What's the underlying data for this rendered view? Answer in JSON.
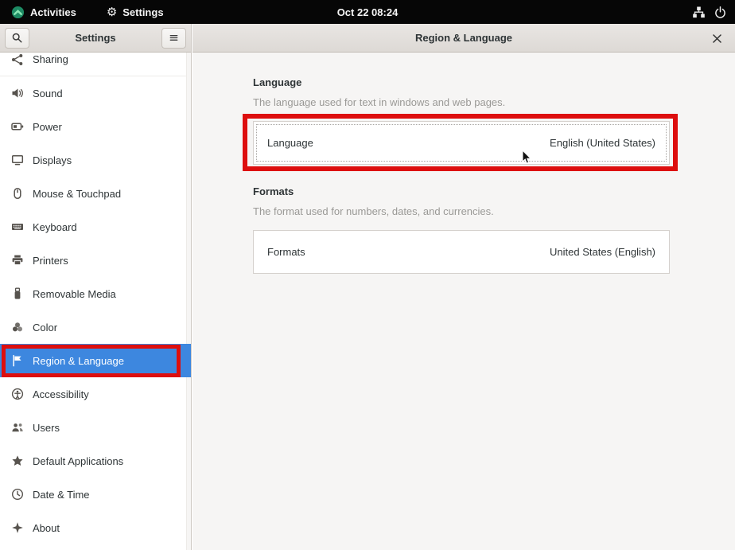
{
  "topbar": {
    "activities_label": "Activities",
    "settings_menu_label": "Settings",
    "clock": "Oct 22 08:24",
    "right_icons": [
      "network-icon",
      "power-icon"
    ]
  },
  "sidebar": {
    "title": "Settings",
    "items": [
      {
        "id": "sharing",
        "label": "Sharing",
        "icon": "share",
        "clipped": true
      },
      {
        "id": "sound",
        "label": "Sound",
        "icon": "sound"
      },
      {
        "id": "power",
        "label": "Power",
        "icon": "battery"
      },
      {
        "id": "displays",
        "label": "Displays",
        "icon": "display"
      },
      {
        "id": "mouse-touchpad",
        "label": "Mouse & Touchpad",
        "icon": "mouse"
      },
      {
        "id": "keyboard",
        "label": "Keyboard",
        "icon": "keyboard"
      },
      {
        "id": "printers",
        "label": "Printers",
        "icon": "printer"
      },
      {
        "id": "removable-media",
        "label": "Removable Media",
        "icon": "usb"
      },
      {
        "id": "color",
        "label": "Color",
        "icon": "color"
      },
      {
        "id": "region-language",
        "label": "Region & Language",
        "icon": "flag",
        "selected": true,
        "annotated": true
      },
      {
        "id": "accessibility",
        "label": "Accessibility",
        "icon": "accessibility"
      },
      {
        "id": "users",
        "label": "Users",
        "icon": "users"
      },
      {
        "id": "default-applications",
        "label": "Default Applications",
        "icon": "star"
      },
      {
        "id": "date-time",
        "label": "Date & Time",
        "icon": "clock"
      },
      {
        "id": "about",
        "label": "About",
        "icon": "sparkle"
      }
    ]
  },
  "main": {
    "title": "Region & Language",
    "sections": [
      {
        "heading": "Language",
        "description": "The language used for text in windows and web pages.",
        "row": {
          "label": "Language",
          "value": "English (United States)"
        },
        "annotated": true,
        "focused": true
      },
      {
        "heading": "Formats",
        "description": "The format used for numbers, dates, and currencies.",
        "row": {
          "label": "Formats",
          "value": "United States (English)"
        }
      }
    ]
  },
  "colors": {
    "accent": "#3d87df",
    "annotation": "#dd0e0e",
    "topbar_bg": "#060606"
  }
}
